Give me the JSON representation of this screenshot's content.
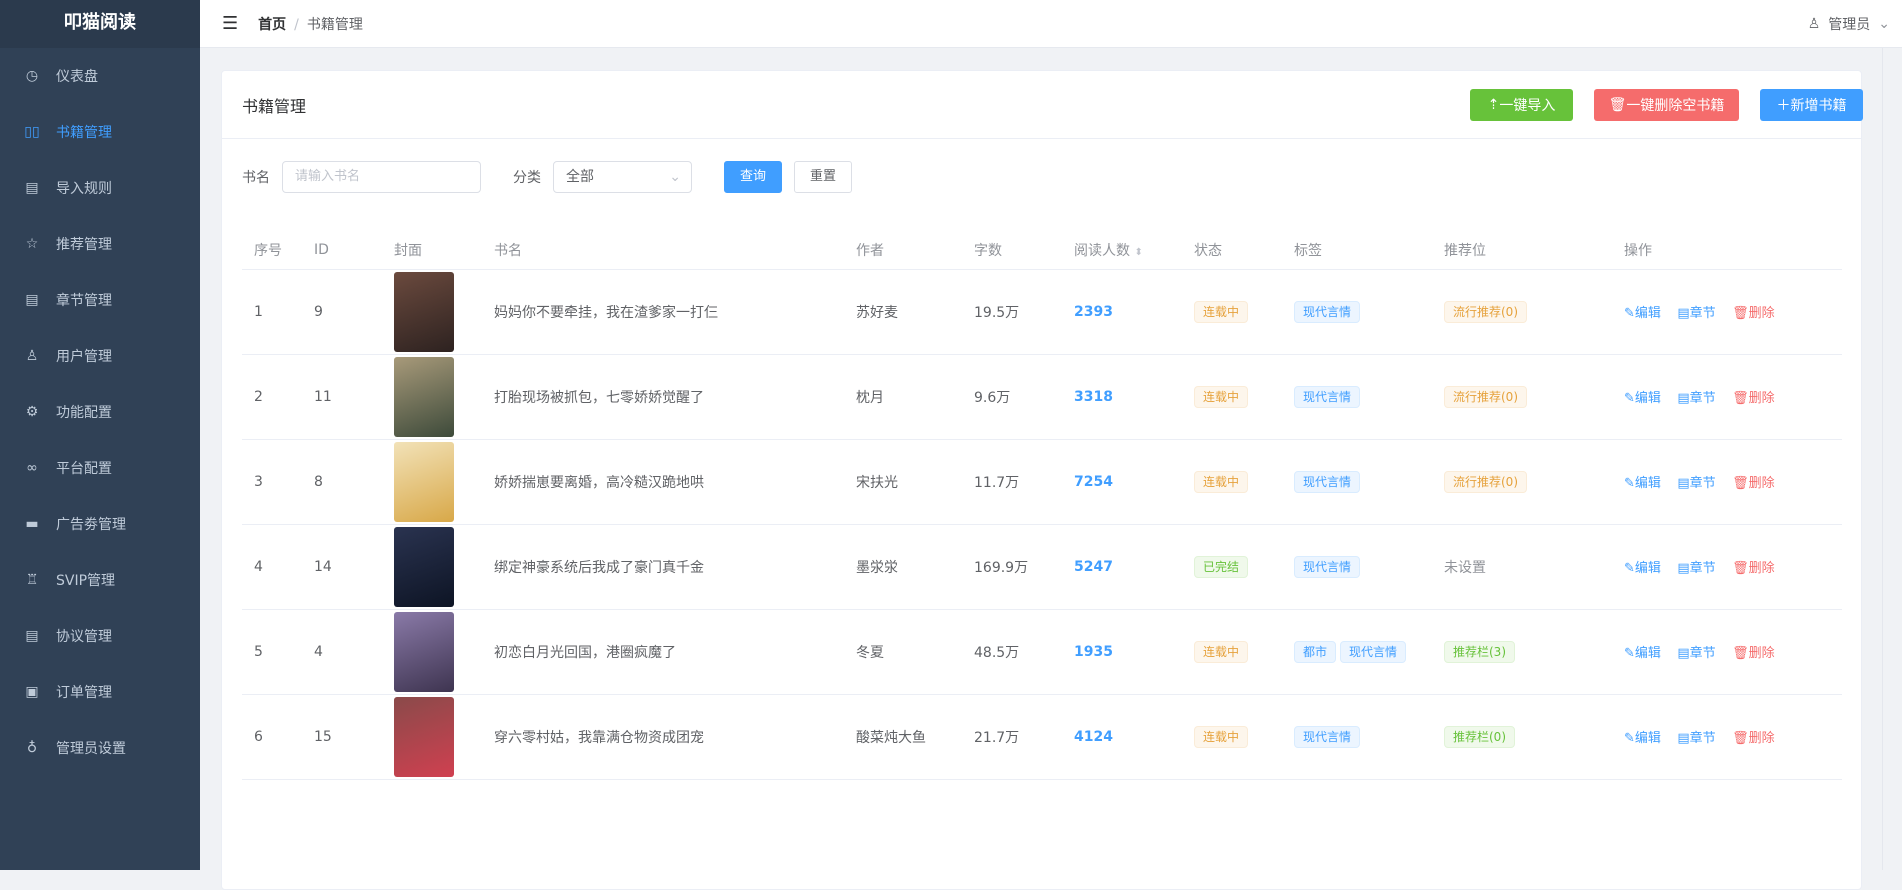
{
  "app": {
    "title": "叩猫阅读"
  },
  "sidebar": {
    "items": [
      {
        "label": "仪表盘",
        "icon": "dashboard-icon",
        "glyph": "◷"
      },
      {
        "label": "书籍管理",
        "icon": "book-icon",
        "glyph": "▯▯",
        "active": true
      },
      {
        "label": "导入规则",
        "icon": "copy-icon",
        "glyph": "▤"
      },
      {
        "label": "推荐管理",
        "icon": "star-icon",
        "glyph": "☆"
      },
      {
        "label": "章节管理",
        "icon": "document-icon",
        "glyph": "▤"
      },
      {
        "label": "用户管理",
        "icon": "user-icon",
        "glyph": "♙"
      },
      {
        "label": "功能配置",
        "icon": "gear-icon",
        "glyph": "⚙"
      },
      {
        "label": "平台配置",
        "icon": "link-icon",
        "glyph": "∞"
      },
      {
        "label": "广告劵管理",
        "icon": "ticket-icon",
        "glyph": "▬"
      },
      {
        "label": "SVIP管理",
        "icon": "medal-icon",
        "glyph": "♖"
      },
      {
        "label": "协议管理",
        "icon": "document-icon",
        "glyph": "▤"
      },
      {
        "label": "订单管理",
        "icon": "clipboard-icon",
        "glyph": "▣"
      },
      {
        "label": "管理员设置",
        "icon": "key-icon",
        "glyph": "♁"
      }
    ]
  },
  "header": {
    "breadcrumb": [
      "首页",
      "书籍管理"
    ],
    "separator": "/",
    "user": "管理员"
  },
  "card": {
    "title": "书籍管理",
    "buttons": {
      "import": "一键导入",
      "delete_empty": "一键删除空书籍",
      "add": "新增书籍"
    }
  },
  "filters": {
    "name_label": "书名",
    "name_placeholder": "请输入书名",
    "category_label": "分类",
    "category_value": "全部",
    "search": "查询",
    "reset": "重置"
  },
  "table": {
    "headers": [
      "序号",
      "ID",
      "封面",
      "书名",
      "作者",
      "字数",
      "阅读人数",
      "状态",
      "标签",
      "推荐位",
      "操作"
    ],
    "actions": {
      "edit": "编辑",
      "chapter": "章节",
      "delete": "删除"
    },
    "rows": [
      {
        "no": "1",
        "id": "9",
        "title": "妈妈你不要牵挂，我在渣爹家一打仨",
        "author": "苏好麦",
        "words": "19.5万",
        "readers": "2393",
        "status": "连载中",
        "status_type": "warn",
        "tags": [
          "现代言情"
        ],
        "slot": "流行推荐(0)",
        "slot_type": "warn",
        "cover": [
          "#6b4a3e",
          "#2d2220"
        ]
      },
      {
        "no": "2",
        "id": "11",
        "title": "打胎现场被抓包，七零娇娇觉醒了",
        "author": "枕月",
        "words": "9.6万",
        "readers": "3318",
        "status": "连载中",
        "status_type": "warn",
        "tags": [
          "现代言情"
        ],
        "slot": "流行推荐(0)",
        "slot_type": "warn",
        "cover": [
          "#a89a7a",
          "#3d4a3a"
        ]
      },
      {
        "no": "3",
        "id": "8",
        "title": "娇娇揣崽要离婚，高冷糙汉跪地哄",
        "author": "宋扶光",
        "words": "11.7万",
        "readers": "7254",
        "status": "连载中",
        "status_type": "warn",
        "tags": [
          "现代言情"
        ],
        "slot": "流行推荐(0)",
        "slot_type": "warn",
        "cover": [
          "#f2e2b8",
          "#d8a848"
        ]
      },
      {
        "no": "4",
        "id": "14",
        "title": "绑定神豪系统后我成了豪门真千金",
        "author": "墨泶泶",
        "words": "169.9万",
        "readers": "5247",
        "status": "已完结",
        "status_type": "succ",
        "tags": [
          "现代言情"
        ],
        "slot": "未设置",
        "slot_type": "none",
        "cover": [
          "#2a3350",
          "#0d1424"
        ]
      },
      {
        "no": "5",
        "id": "4",
        "title": "初恋白月光回国，港圈疯魔了",
        "author": "冬夏",
        "words": "48.5万",
        "readers": "1935",
        "status": "连载中",
        "status_type": "warn",
        "tags": [
          "都市",
          "现代言情"
        ],
        "slot": "推荐栏(3)",
        "slot_type": "succ",
        "cover": [
          "#8a7aa8",
          "#3e3450"
        ]
      },
      {
        "no": "6",
        "id": "15",
        "title": "穿六零村姑，我靠满仓物资成团宠",
        "author": "酸菜炖大鱼",
        "words": "21.7万",
        "readers": "4124",
        "status": "连载中",
        "status_type": "warn",
        "tags": [
          "现代言情"
        ],
        "slot": "推荐栏(0)",
        "slot_type": "succ",
        "cover": [
          "#8a4a4a",
          "#d04050"
        ]
      }
    ]
  }
}
